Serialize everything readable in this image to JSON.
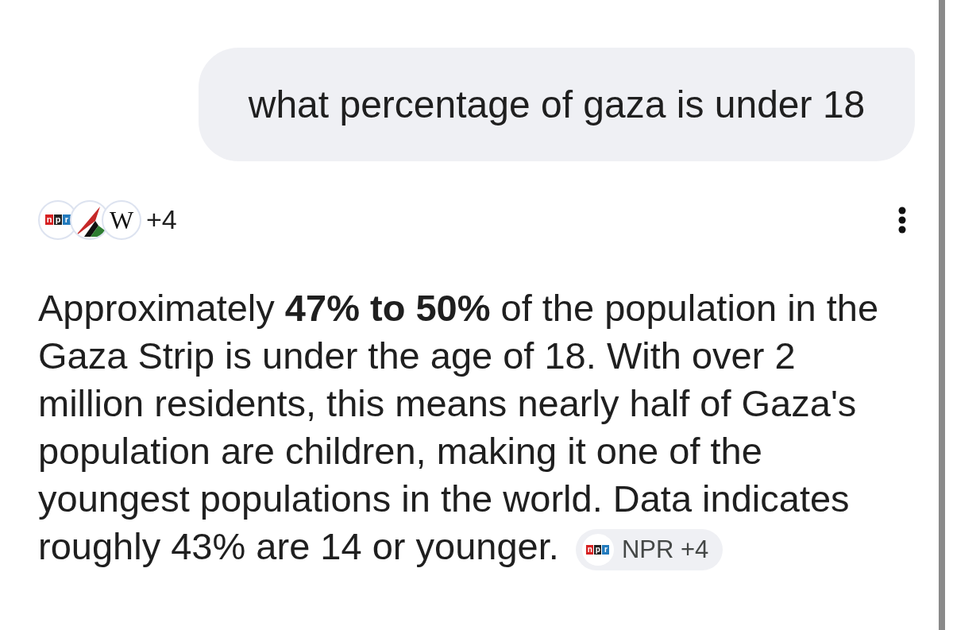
{
  "user_message": "what percentage of gaza is under 18",
  "sources": {
    "icons": [
      {
        "kind": "npr",
        "logo": [
          "n",
          "p",
          "r"
        ]
      },
      {
        "kind": "flag"
      },
      {
        "kind": "wiki",
        "logo": "W"
      }
    ],
    "more": "+4"
  },
  "answer": {
    "text": "Approximately **47% to 50%** of the population in the Gaza Strip is under the age of 18. With over 2 million residents, this means nearly half of Gaza's population are children, making it one of the youngest populations in the world. Data indicates roughly 43% are 14 or younger.",
    "citation": {
      "logo": [
        "n",
        "p",
        "r"
      ],
      "label": "NPR +4"
    }
  }
}
